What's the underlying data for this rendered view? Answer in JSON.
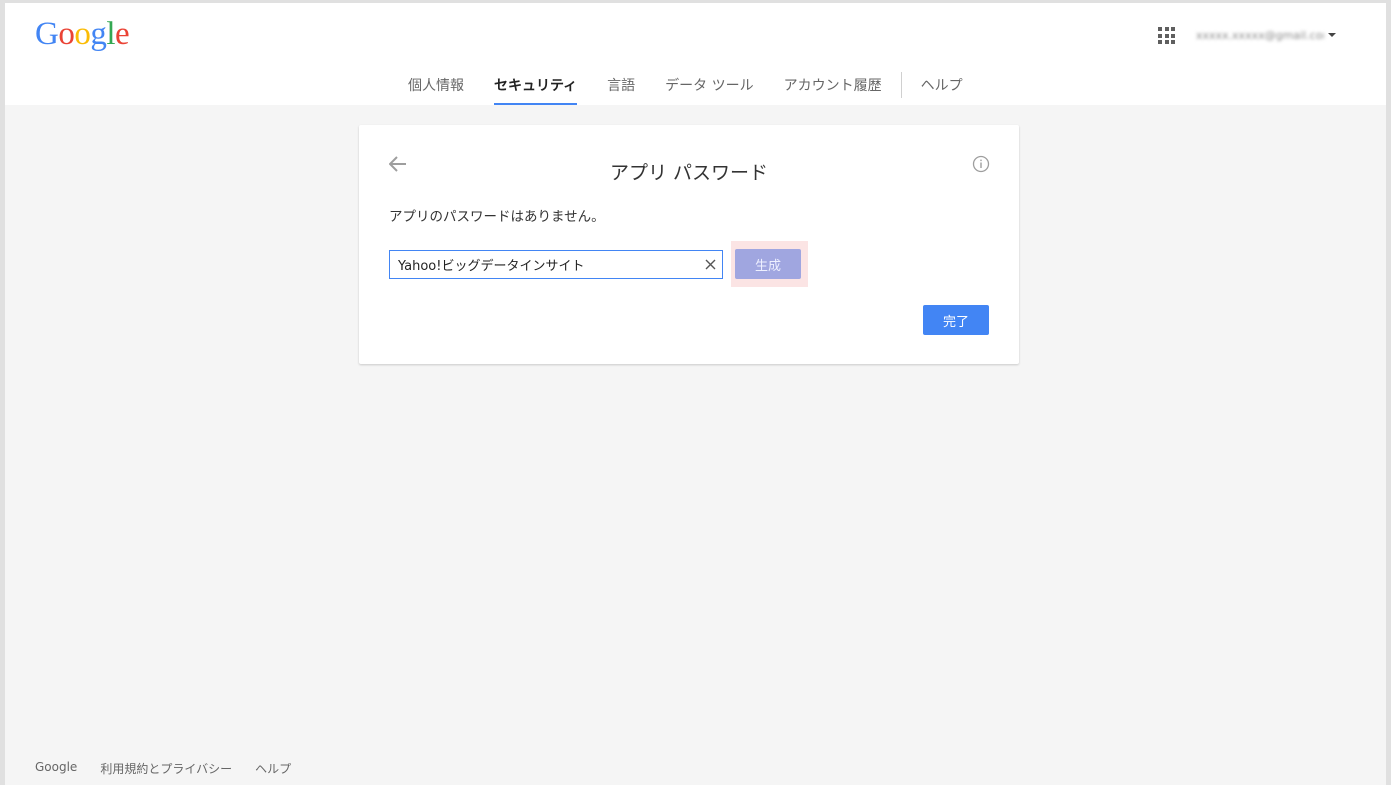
{
  "header": {
    "logo": [
      "G",
      "o",
      "o",
      "g",
      "l",
      "e"
    ],
    "logo_colors": [
      "#4285f4",
      "#ea4335",
      "#fbbc05",
      "#4285f4",
      "#34a853",
      "#ea4335"
    ],
    "account_email": "xxxxx.xxxxx@gmail.com",
    "icons": {
      "apps": "apps-grid-icon",
      "caret": "caret-down-icon"
    }
  },
  "nav": {
    "tabs": [
      {
        "label": "個人情報",
        "active": false
      },
      {
        "label": "セキュリティ",
        "active": true
      },
      {
        "label": "言語",
        "active": false
      },
      {
        "label": "データ ツール",
        "active": false
      },
      {
        "label": "アカウント履歴",
        "active": false
      }
    ],
    "help": "ヘルプ"
  },
  "card": {
    "title": "アプリ パスワード",
    "message": "アプリのパスワードはありません。",
    "input_value": "Yahoo!ビッグデータインサイト",
    "generate_label": "生成",
    "done_label": "完了",
    "icons": {
      "back": "back-arrow-icon",
      "info": "info-icon",
      "clear": "clear-icon"
    }
  },
  "footer": {
    "links": [
      "Google",
      "利用規約とプライバシー",
      "ヘルプ"
    ]
  },
  "colors": {
    "accent": "#4285f4",
    "generate_disabled": "#a0a6e0",
    "highlight": "#fbe4e4",
    "background": "#f5f5f5"
  }
}
